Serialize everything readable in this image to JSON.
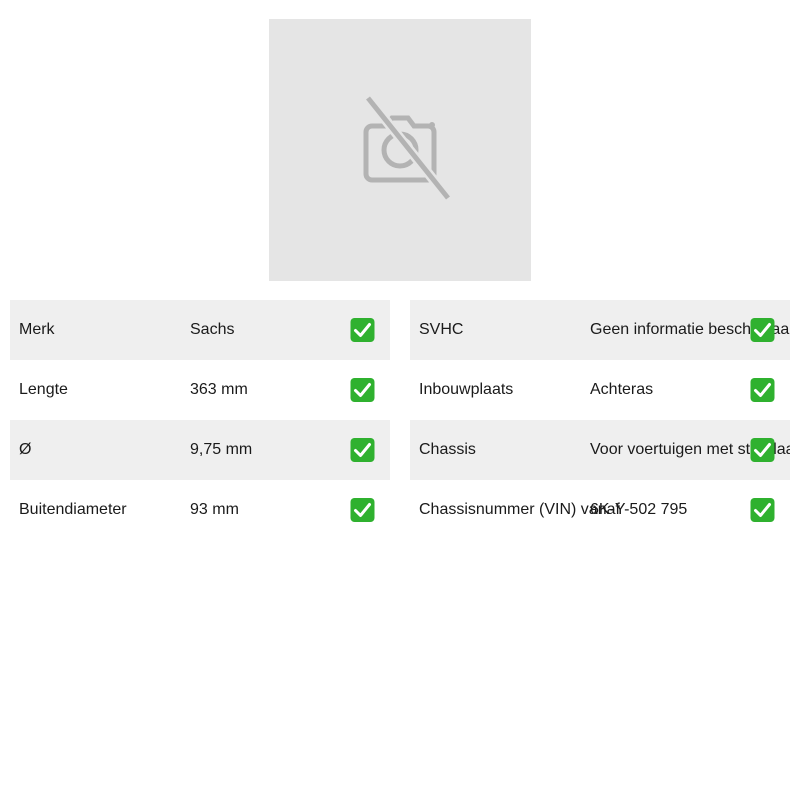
{
  "product_image": {
    "icon": "no-photo-icon"
  },
  "specs_left": [
    {
      "label": "Merk",
      "value": "Sachs",
      "status_icon": "check-icon"
    },
    {
      "label": "Lengte",
      "value": "363 mm",
      "status_icon": "check-icon"
    },
    {
      "label": "Ø",
      "value": "9,75 mm",
      "status_icon": "check-icon"
    },
    {
      "label": "Buitendiameter",
      "value": "93 mm",
      "status_icon": "check-icon"
    }
  ],
  "specs_right": [
    {
      "label": "SVHC",
      "value": "Geen informatie beschikbaar",
      "status_icon": "check-icon"
    },
    {
      "label": "Inbouwplaats",
      "value": "Achteras",
      "status_icon": "check-icon"
    },
    {
      "label": "Chassis",
      "value": "Voor voertuigen met standaard onderstel",
      "status_icon": "check-icon"
    },
    {
      "label": "Chassisnummer (VIN) vanaf",
      "value": "6K-Y-502 795",
      "status_icon": "check-icon"
    }
  ],
  "colors": {
    "placeholder_bg": "#e5e5e5",
    "placeholder_icon": "#b3b3b3",
    "row_shade": "#efefef",
    "check_green": "#2fb12f"
  }
}
